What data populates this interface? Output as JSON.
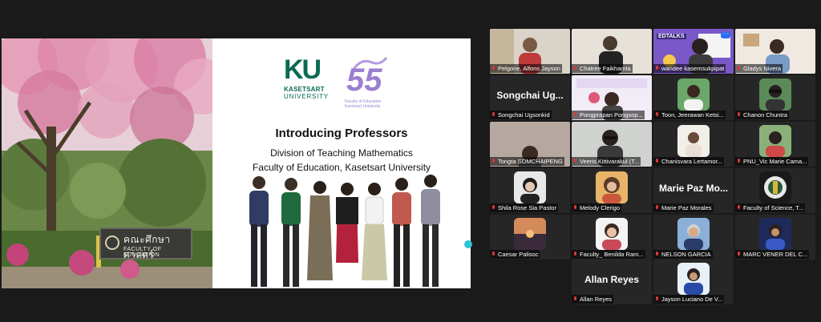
{
  "slide": {
    "sign_thai": "คณะศึกษาศาสตร์",
    "sign_en": "FACULTY OF EDUCATION",
    "logo_ku": "KU",
    "logo_kasetsart": "KASETSART",
    "logo_university": "UNIVERSITY",
    "logo_55": "55",
    "logo_55_caption": "Faculty of Education Kasetsart University",
    "title": "Introducing Professors",
    "subtitle_1": "Division of Teaching Mathematics",
    "subtitle_2": "Faculty of Education, Kasetsart University"
  },
  "participants": [
    {
      "name": "Pelgone, Alfons Jayson",
      "type": "video"
    },
    {
      "name": "Chatree Faikhamta",
      "type": "video"
    },
    {
      "name": "wandee kasemsukpipat",
      "type": "video",
      "active": true,
      "badge": "EDTALKS"
    },
    {
      "name": "Gladys Nivera",
      "type": "video"
    },
    {
      "name": "Songchai Ugsonkid",
      "type": "text",
      "big": "Songchai Ug..."
    },
    {
      "name": "Pongprapan Pongsop...",
      "type": "video"
    },
    {
      "name": "Toon, Jeerawan Ketsi...",
      "type": "avatar"
    },
    {
      "name": "Chanon Chuntra",
      "type": "avatar"
    },
    {
      "name": "Tongta SOMCHAIPENG",
      "type": "video"
    },
    {
      "name": "Veeris Kittivarakul (T...",
      "type": "video"
    },
    {
      "name": "Chanisvara Lertamor...",
      "type": "avatar"
    },
    {
      "name": "PNU_Vic Marie Cama...",
      "type": "avatar"
    },
    {
      "name": "Shila Rose Sia Pastor",
      "type": "avatar"
    },
    {
      "name": "Melody Clerigo",
      "type": "avatar"
    },
    {
      "name": "Marie Paz Morales",
      "type": "text",
      "big": "Marie Paz Mo..."
    },
    {
      "name": "Faculty of Science, T...",
      "type": "avatar"
    },
    {
      "name": "Caesar Palisoc",
      "type": "avatar"
    },
    {
      "name": "Faculty_ Benilda Ram...",
      "type": "avatar"
    },
    {
      "name": "NELSON GARCIA",
      "type": "avatar"
    },
    {
      "name": "MARC VENER DEL C...",
      "type": "avatar"
    },
    {
      "name": "Allan Reyes",
      "type": "text",
      "big": "Allan Reyes"
    },
    {
      "name": "Jayson Luciano De V...",
      "type": "avatar"
    }
  ],
  "colors": {
    "background": "#1a1a1a",
    "tile": "#262626",
    "active_outline": "#36c26b",
    "ku_green": "#0b6b52",
    "anniv_purple": "#9b7fd0",
    "mic_muted": "#e0353b"
  }
}
